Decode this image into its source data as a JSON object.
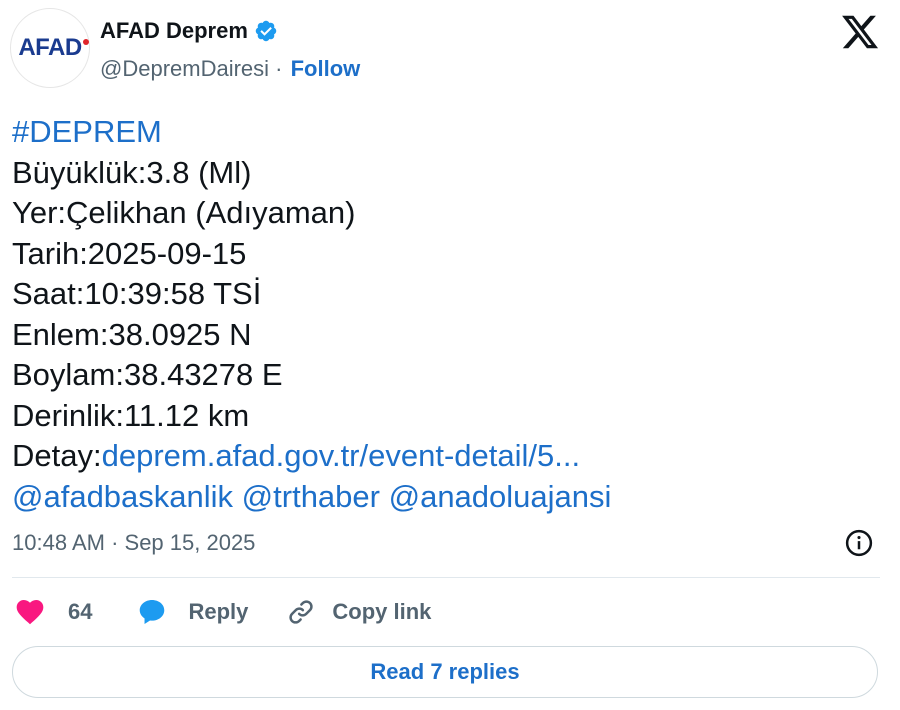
{
  "author": {
    "avatar_text": "AFAD",
    "display_name": "AFAD Deprem",
    "handle": "@DepremDairesi",
    "separator": " · ",
    "follow_label": "Follow"
  },
  "tweet": {
    "hashtag": "#DEPREM",
    "lines": [
      "Büyüklük:3.8 (Ml)",
      "Yer:Çelikhan (Adıyaman)",
      "Tarih:2025-09-15",
      "Saat:10:39:58 TSİ",
      "Enlem:38.0925 N",
      "Boylam:38.43278 E",
      "Derinlik:11.12 km"
    ],
    "detail_label": "Detay:",
    "detail_link": "deprem.afad.gov.tr/event-detail/5...",
    "mentions": [
      "@afadbaskanlik",
      "@trthaber",
      "@anadoluajansi"
    ]
  },
  "meta": {
    "time": "10:48 AM",
    "separator": " · ",
    "date": "Sep 15, 2025"
  },
  "actions": {
    "like_count": "64",
    "reply_label": "Reply",
    "copy_label": "Copy link"
  },
  "read_replies_label": "Read 7 replies",
  "colors": {
    "link": "#1d6fc9",
    "like": "#f91880",
    "verified": "#1d9bf0",
    "muted": "#536471",
    "avatar_brand": "#1a3b8f",
    "avatar_dot": "#e0242a"
  },
  "icons": [
    "verified-badge-icon",
    "x-logo-icon",
    "info-icon",
    "heart-icon",
    "reply-bubble-icon",
    "link-icon"
  ]
}
